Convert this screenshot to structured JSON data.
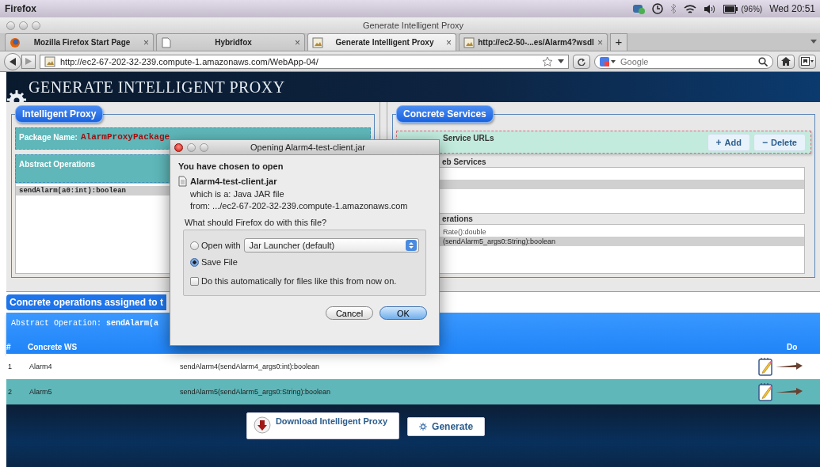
{
  "menubar": {
    "app": "Firefox",
    "battery": "(96%)",
    "clock": "Wed 20:51"
  },
  "window": {
    "title": "Generate Intelligent Proxy"
  },
  "tabs": [
    {
      "label": "Mozilla Firefox Start Page",
      "kind": "firefox",
      "selected": false,
      "close": "×"
    },
    {
      "label": "Hybridfox",
      "kind": "page",
      "selected": false,
      "close": "×"
    },
    {
      "label": "Generate Intelligent Proxy",
      "kind": "image",
      "selected": true,
      "close": "×"
    },
    {
      "label": "http://ec2-50-...es/Alarm4?wsdl",
      "kind": "image",
      "selected": false,
      "close": "×"
    }
  ],
  "add_tab": "+",
  "navbar": {
    "url": "http://ec2-67-202-32-239.compute-1.amazonaws.com/WebApp-04/",
    "search": {
      "placeholder": "Google"
    }
  },
  "page": {
    "title": "GENERATE INTELLIGENT PROXY",
    "proxy_panel": {
      "legend": "Intelligent Proxy",
      "package_label": "Package Name:",
      "package_value": "AlarmProxyPackage",
      "operations_label": "Abstract Operations",
      "operations": [
        {
          "text": "sendAlarm(a0:int):boolean",
          "selected": true
        }
      ]
    },
    "services_panel": {
      "legend": "Concrete Services",
      "urls_label": "Service URLs",
      "buttons": [
        {
          "icon": "+",
          "label": "Add"
        },
        {
          "icon": "−",
          "label": "Delete"
        }
      ],
      "web_services": {
        "label": "eb Services",
        "rows": [
          {
            "selected": false
          },
          {
            "selected": true
          }
        ]
      },
      "operations": {
        "label": "erations",
        "rows": [
          {
            "text": "Rate():double",
            "selected": false
          },
          {
            "text": "(sendAlarm5_args0:String):boolean",
            "selected": true
          }
        ]
      }
    },
    "assigned": {
      "title": "Concrete operations assigned to t",
      "abstract_operation": "Abstract Operation: **sendAlarm(a**",
      "columns": [
        "#",
        "Concrete WS",
        "Do"
      ],
      "rows": [
        {
          "number": "1",
          "service": "Alarm4",
          "operation": "sendAlarm4(sendAlarm4_args0:int):boolean"
        },
        {
          "number": "2",
          "service": "Alarm5",
          "operation": "sendAlarm5(sendAlarm5_args0:String):boolean"
        }
      ]
    },
    "footer_buttons": [
      {
        "label": "Download Intelligent Proxy",
        "kind": "download"
      },
      {
        "label": "Generate",
        "kind": "generate"
      }
    ]
  },
  "dialog": {
    "title": "Opening Alarm4-test-client.jar",
    "heading": "You have chosen to open",
    "filename": "Alarm4-test-client.jar",
    "type_line": "which is a: Java JAR file",
    "from_line": "from: .../ec2-67-202-32-239.compute-1.amazonaws.com",
    "question": "What should Firefox do with this file?",
    "options": [
      {
        "label": "Open with",
        "selected": false,
        "select": "Jar Launcher (default)"
      },
      {
        "label": "Save File",
        "selected": true
      }
    ],
    "auto": {
      "label": "Do this automatically for files like this from now on.",
      "checked": false
    },
    "buttons": [
      {
        "label": "Cancel",
        "default": false
      },
      {
        "label": "OK",
        "default": true
      }
    ]
  }
}
